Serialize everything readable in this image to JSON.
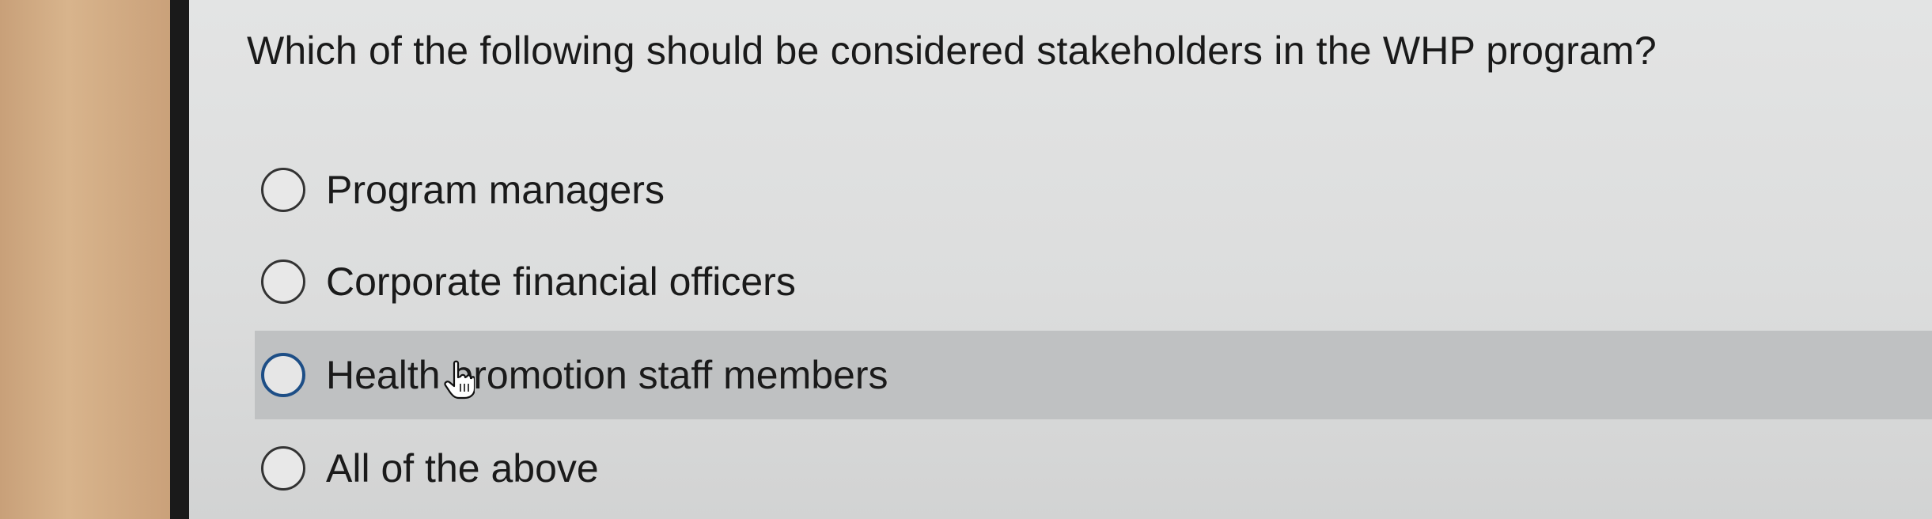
{
  "question": {
    "text": "Which of the following should be considered stakeholders in the WHP program?"
  },
  "options": [
    {
      "label": "Program managers",
      "hovered": false
    },
    {
      "label": "Corporate financial officers",
      "hovered": false
    },
    {
      "label": "Health promotion staff members",
      "hovered": true
    },
    {
      "label": "All of the above",
      "hovered": false
    }
  ],
  "colors": {
    "hover_row": "#bfc1c2",
    "hover_radio_border": "#1d4e86"
  },
  "cursor": {
    "icon": "hand-pointer-icon"
  }
}
